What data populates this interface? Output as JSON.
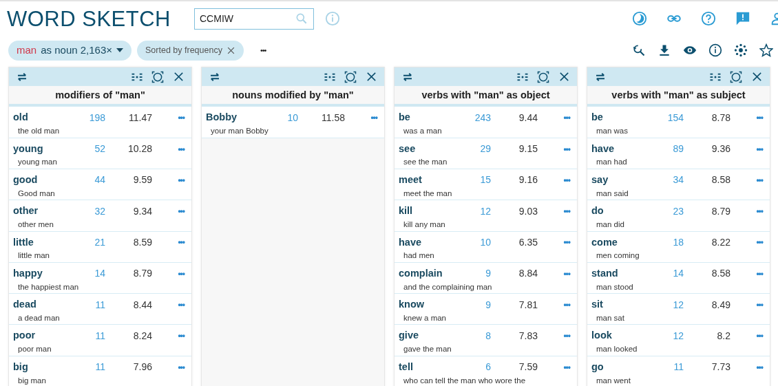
{
  "title": "WORD SKETCH",
  "search": {
    "value": "CCMIW"
  },
  "query": {
    "lemma": "man",
    "rest": "as noun 2,163×"
  },
  "sort_chip": {
    "label": "Sorted by frequency"
  },
  "more": "•••",
  "panels": [
    {
      "title": "modifiers of \"man\"",
      "rows": [
        {
          "word": "old",
          "freq": "198",
          "score": "11.47",
          "example": "the old man"
        },
        {
          "word": "young",
          "freq": "52",
          "score": "10.28",
          "example": "young man"
        },
        {
          "word": "good",
          "freq": "44",
          "score": "9.59",
          "example": "Good man"
        },
        {
          "word": "other",
          "freq": "32",
          "score": "9.34",
          "example": "other men"
        },
        {
          "word": "little",
          "freq": "21",
          "score": "8.59",
          "example": "little man"
        },
        {
          "word": "happy",
          "freq": "14",
          "score": "8.79",
          "example": "the happiest man"
        },
        {
          "word": "dead",
          "freq": "11",
          "score": "8.44",
          "example": "a dead man"
        },
        {
          "word": "poor",
          "freq": "11",
          "score": "8.24",
          "example": "poor man"
        },
        {
          "word": "big",
          "freq": "11",
          "score": "7.96",
          "example": "big man"
        }
      ]
    },
    {
      "title": "nouns modified by \"man\"",
      "rows": [
        {
          "word": "Bobby",
          "freq": "10",
          "score": "11.58",
          "example": "your man Bobby"
        }
      ]
    },
    {
      "title": "verbs with \"man\" as object",
      "rows": [
        {
          "word": "be",
          "freq": "243",
          "score": "9.44",
          "example": "was a man"
        },
        {
          "word": "see",
          "freq": "29",
          "score": "9.15",
          "example": "see the man"
        },
        {
          "word": "meet",
          "freq": "15",
          "score": "9.16",
          "example": "meet the man"
        },
        {
          "word": "kill",
          "freq": "12",
          "score": "9.03",
          "example": "kill any man"
        },
        {
          "word": "have",
          "freq": "10",
          "score": "6.35",
          "example": "had men"
        },
        {
          "word": "complain",
          "freq": "9",
          "score": "8.84",
          "example": "and the complaining man"
        },
        {
          "word": "know",
          "freq": "9",
          "score": "7.81",
          "example": "knew a man"
        },
        {
          "word": "give",
          "freq": "8",
          "score": "7.83",
          "example": "gave the man"
        },
        {
          "word": "tell",
          "freq": "6",
          "score": "7.59",
          "example": "who can tell the man who wore the"
        }
      ]
    },
    {
      "title": "verbs with \"man\" as subject",
      "rows": [
        {
          "word": "be",
          "freq": "154",
          "score": "8.78",
          "example": "man was"
        },
        {
          "word": "have",
          "freq": "89",
          "score": "9.36",
          "example": "man had"
        },
        {
          "word": "say",
          "freq": "34",
          "score": "8.58",
          "example": "man said"
        },
        {
          "word": "do",
          "freq": "23",
          "score": "8.79",
          "example": "man did"
        },
        {
          "word": "come",
          "freq": "18",
          "score": "8.22",
          "example": "men coming"
        },
        {
          "word": "stand",
          "freq": "14",
          "score": "8.58",
          "example": "man stood"
        },
        {
          "word": "sit",
          "freq": "12",
          "score": "8.49",
          "example": "man sat"
        },
        {
          "word": "look",
          "freq": "12",
          "score": "8.2",
          "example": "man looked"
        },
        {
          "word": "go",
          "freq": "11",
          "score": "7.73",
          "example": "man went"
        }
      ]
    }
  ]
}
